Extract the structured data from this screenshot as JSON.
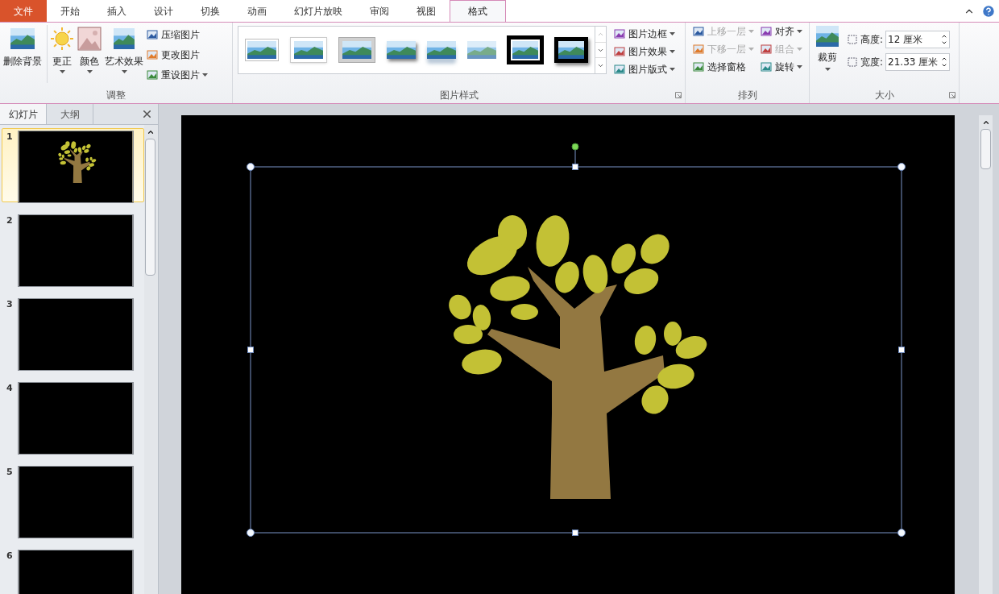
{
  "ribbon_tabs": [
    {
      "label": "文件",
      "kind": "file",
      "selected": false
    },
    {
      "label": "开始",
      "kind": "tab",
      "selected": false
    },
    {
      "label": "插入",
      "kind": "tab",
      "selected": false
    },
    {
      "label": "设计",
      "kind": "tab",
      "selected": false
    },
    {
      "label": "切换",
      "kind": "tab",
      "selected": false
    },
    {
      "label": "动画",
      "kind": "tab",
      "selected": false
    },
    {
      "label": "幻灯片放映",
      "kind": "tab",
      "selected": false
    },
    {
      "label": "审阅",
      "kind": "tab",
      "selected": false
    },
    {
      "label": "视图",
      "kind": "tab",
      "selected": false
    },
    {
      "label": "格式",
      "kind": "tab",
      "selected": true
    }
  ],
  "adjust_group": {
    "title": "调整",
    "large_buttons": [
      {
        "label": "删除背景",
        "dropdown": false
      },
      {
        "label": "更正",
        "dropdown": true
      },
      {
        "label": "颜色",
        "dropdown": true
      },
      {
        "label": "艺术效果",
        "dropdown": true
      }
    ],
    "small_buttons": [
      {
        "label": "压缩图片",
        "dropdown": false
      },
      {
        "label": "更改图片",
        "dropdown": false
      },
      {
        "label": "重设图片",
        "dropdown": true
      }
    ]
  },
  "picture_styles_group": {
    "title": "图片样式",
    "gallery": [
      {
        "kind": "thin-frame"
      },
      {
        "kind": "white-frame"
      },
      {
        "kind": "gray-frame"
      },
      {
        "kind": "shadow"
      },
      {
        "kind": "reflection"
      },
      {
        "kind": "soft-edge"
      },
      {
        "kind": "black-double"
      },
      {
        "kind": "black-shadow"
      }
    ],
    "commands": [
      {
        "label": "图片边框",
        "dropdown": true
      },
      {
        "label": "图片效果",
        "dropdown": true
      },
      {
        "label": "图片版式",
        "dropdown": true
      }
    ]
  },
  "arrange_group": {
    "title": "排列",
    "commands": [
      {
        "label": "上移一层",
        "disabled": true,
        "dropdown": true
      },
      {
        "label": "下移一层",
        "disabled": true,
        "dropdown": true
      },
      {
        "label": "选择窗格",
        "disabled": false,
        "dropdown": false
      },
      {
        "label": "对齐",
        "disabled": false,
        "dropdown": true
      },
      {
        "label": "组合",
        "disabled": true,
        "dropdown": true
      },
      {
        "label": "旋转",
        "disabled": false,
        "dropdown": true
      }
    ]
  },
  "size_group": {
    "title": "大小",
    "crop": {
      "label": "裁剪"
    },
    "height": {
      "label": "高度:",
      "value": "12 厘米"
    },
    "width": {
      "label": "宽度:",
      "value": "21.33 厘米"
    }
  },
  "slides_panel": {
    "tabs": [
      {
        "label": "幻灯片",
        "selected": true
      },
      {
        "label": "大纲",
        "selected": false
      }
    ],
    "slides": [
      {
        "number": "1",
        "selected": true,
        "kind": "tree"
      },
      {
        "number": "2",
        "selected": false,
        "kind": "blank"
      },
      {
        "number": "3",
        "selected": false,
        "kind": "blank"
      },
      {
        "number": "4",
        "selected": false,
        "kind": "blank"
      },
      {
        "number": "5",
        "selected": false,
        "kind": "blank"
      },
      {
        "number": "6",
        "selected": false,
        "kind": "blank"
      }
    ]
  },
  "slide": {
    "kind": "tree",
    "picture_selected": true
  }
}
